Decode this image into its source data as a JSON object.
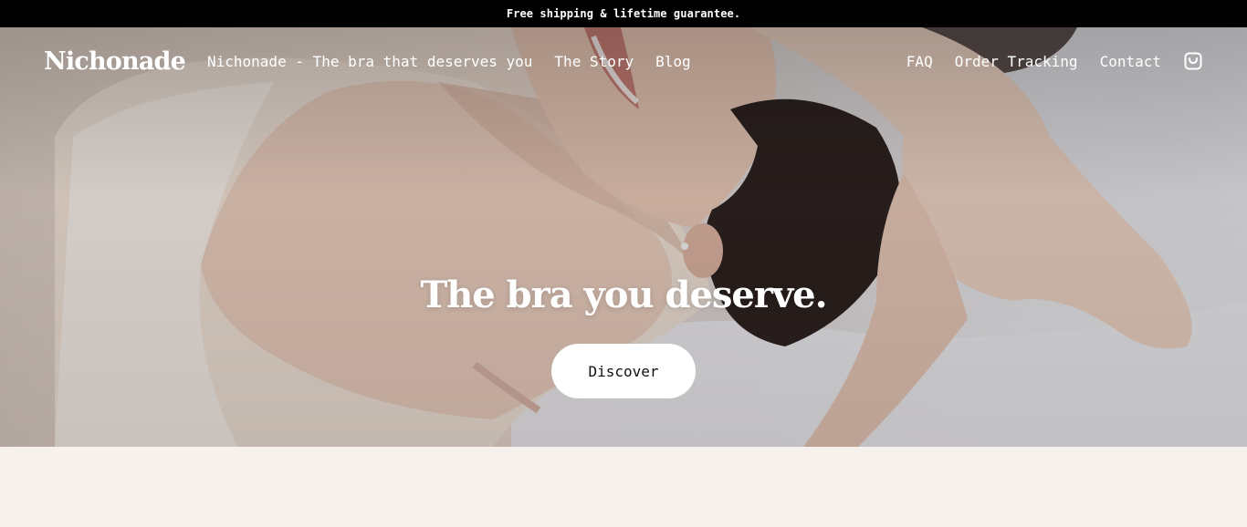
{
  "announcement": {
    "text": "Free shipping & lifetime guarantee."
  },
  "header": {
    "logo": "Nichonade",
    "nav_left": [
      {
        "label": "Nichonade - The bra that deserves you"
      },
      {
        "label": "The Story"
      },
      {
        "label": "Blog"
      }
    ],
    "nav_right": [
      {
        "label": "FAQ"
      },
      {
        "label": "Order Tracking"
      },
      {
        "label": "Contact"
      }
    ],
    "cart_icon": "shopping-bag-icon"
  },
  "hero": {
    "title": "The bra you deserve.",
    "cta_label": "Discover",
    "image_description_icon": "hero-photo"
  },
  "colors": {
    "announcement_bg": "#000000",
    "text_on_hero": "#ffffff",
    "button_bg": "#ffffff",
    "page_bg": "#f6f1ec"
  }
}
